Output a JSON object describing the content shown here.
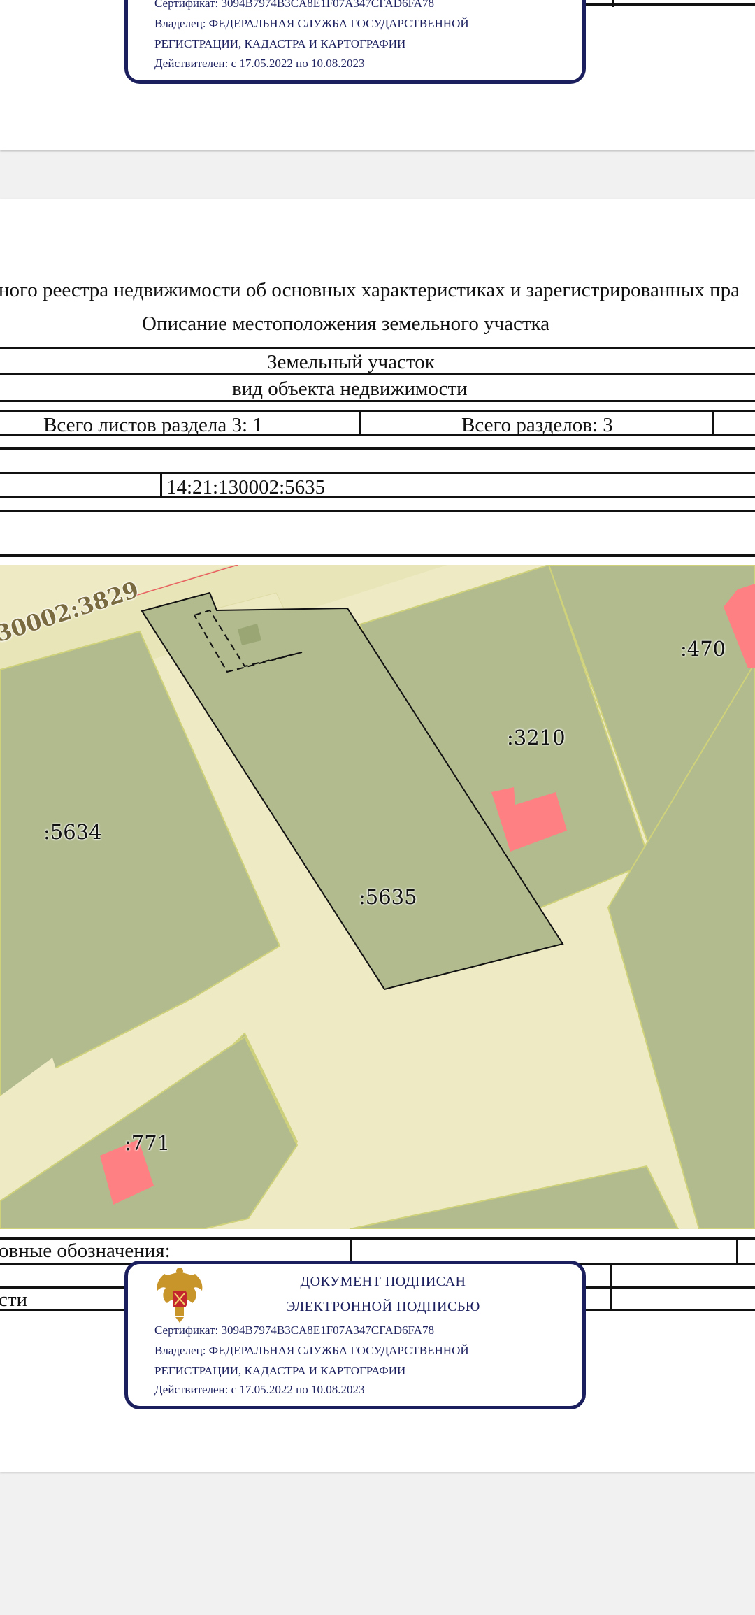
{
  "document": {
    "heading_main": "ного реестра недвижимости об основных характеристиках и зарегистрированных пра",
    "heading_sub": "Описание местоположения земельного участка",
    "object_type": "Земельный участок",
    "object_type_caption": "вид объекта недвижимости",
    "sheets_in_section": "Всего листов раздела 3: 1",
    "sections_total": "Всего разделов: 3",
    "cadastral_number": "14:21:130002:5635",
    "legend_label": "овные обозначения:",
    "bottom_row_label": "сти"
  },
  "stamp": {
    "title_line1": "ДОКУМЕНТ ПОДПИСАН",
    "title_line2": "ЭЛЕКТРОННОЙ ПОДПИСЬЮ",
    "certificate": "Сертификат: 3094B7974B3CA8E1F07A347CFAD6FA78",
    "owner_line1": "Владелец: ФЕДЕРАЛЬНАЯ СЛУЖБА ГОСУДАРСТВЕННОЙ",
    "owner_line2": "РЕГИСТРАЦИИ, КАДАСТРА И КАРТОГРАФИИ",
    "validity": "Действителен: с 17.05.2022 по 10.08.2023",
    "emblem_icon": "coat-of-arms-icon"
  },
  "map": {
    "labels": {
      "road": "30002:3829",
      "p470": ":470",
      "p3210": ":3210",
      "p5634": ":5634",
      "p5635": ":5635",
      "p771": ":771"
    },
    "colors": {
      "parcel": "#b1bb8e",
      "ground": "#eeeac4",
      "building": "#ff8082",
      "road": "#e8e5b8"
    }
  }
}
